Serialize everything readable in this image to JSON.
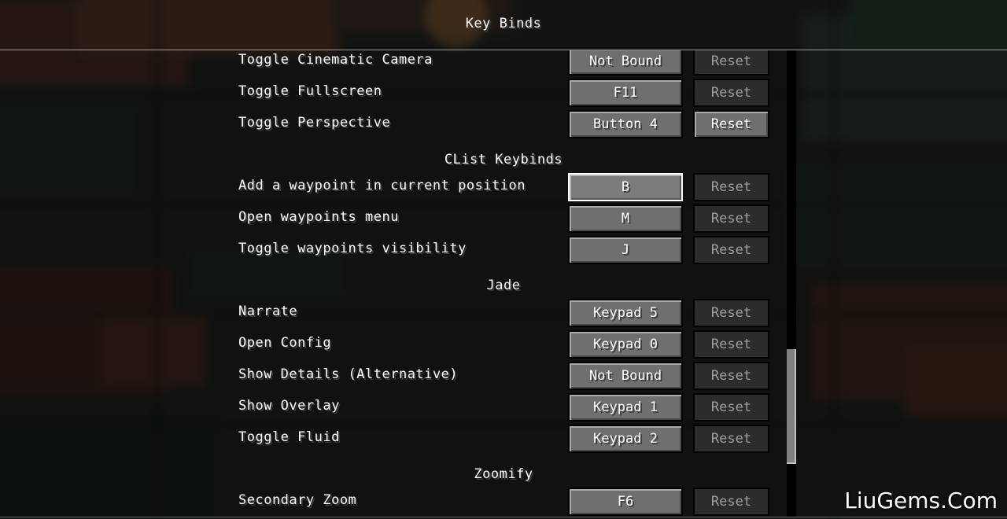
{
  "screen": {
    "title": "Key Binds"
  },
  "rows": [
    {
      "type": "key",
      "action": "Toggle Cinematic Camera",
      "key": "Not Bound",
      "reset": "Reset",
      "reset_enabled": false,
      "selected": false
    },
    {
      "type": "key",
      "action": "Toggle Fullscreen",
      "key": "F11",
      "reset": "Reset",
      "reset_enabled": false,
      "selected": false
    },
    {
      "type": "key",
      "action": "Toggle Perspective",
      "key": "Button 4",
      "reset": "Reset",
      "reset_enabled": true,
      "selected": false
    },
    {
      "type": "category",
      "label": "CList Keybinds"
    },
    {
      "type": "key",
      "action": "Add a waypoint in current position",
      "key": "B",
      "reset": "Reset",
      "reset_enabled": false,
      "selected": true
    },
    {
      "type": "key",
      "action": "Open waypoints menu",
      "key": "M",
      "reset": "Reset",
      "reset_enabled": false,
      "selected": false
    },
    {
      "type": "key",
      "action": "Toggle waypoints visibility",
      "key": "J",
      "reset": "Reset",
      "reset_enabled": false,
      "selected": false
    },
    {
      "type": "category",
      "label": "Jade"
    },
    {
      "type": "key",
      "action": "Narrate",
      "key": "Keypad 5",
      "reset": "Reset",
      "reset_enabled": false,
      "selected": false
    },
    {
      "type": "key",
      "action": "Open Config",
      "key": "Keypad 0",
      "reset": "Reset",
      "reset_enabled": false,
      "selected": false
    },
    {
      "type": "key",
      "action": "Show Details (Alternative)",
      "key": "Not Bound",
      "reset": "Reset",
      "reset_enabled": false,
      "selected": false
    },
    {
      "type": "key",
      "action": "Show Overlay",
      "key": "Keypad 1",
      "reset": "Reset",
      "reset_enabled": false,
      "selected": false
    },
    {
      "type": "key",
      "action": "Toggle Fluid",
      "key": "Keypad 2",
      "reset": "Reset",
      "reset_enabled": false,
      "selected": false
    },
    {
      "type": "category",
      "label": "Zoomify"
    },
    {
      "type": "key",
      "action": "Secondary Zoom",
      "key": "F6",
      "reset": "Reset",
      "reset_enabled": false,
      "selected": false
    }
  ],
  "watermark": "LiuGems.Com",
  "colors": {
    "text": "#ffffff",
    "button": "#6f6f6f",
    "button_disabled": "#2c2c2c",
    "selected_border": "#ffffff",
    "scrollbar_track": "#000000",
    "scrollbar_thumb": "#808080"
  }
}
